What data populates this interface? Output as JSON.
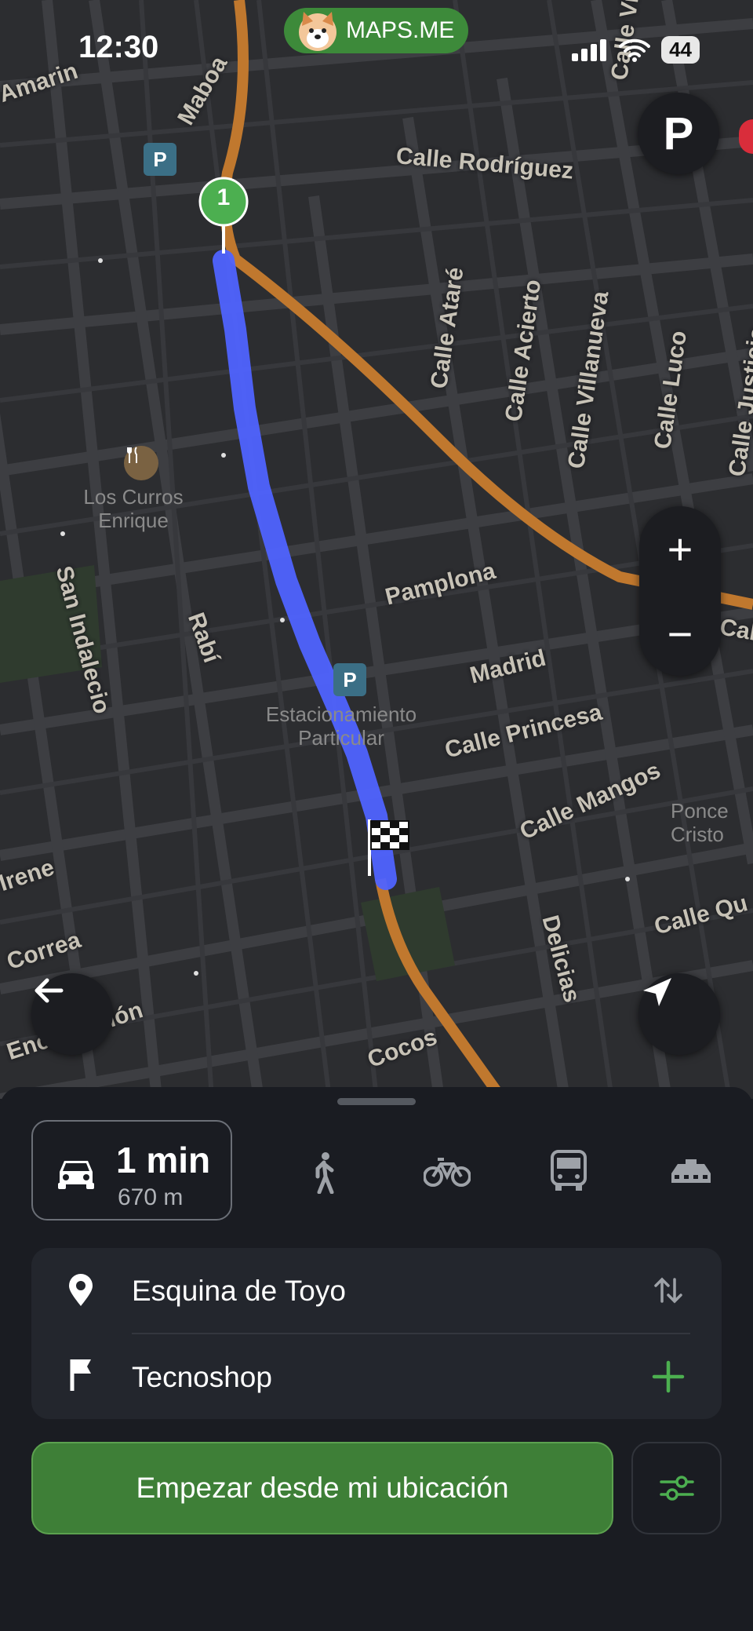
{
  "status": {
    "time": "12:30",
    "battery": "44",
    "app_pill": "MAPS.ME"
  },
  "map": {
    "streets": [
      "Maboa",
      "Calle Rodríguez",
      "Calle Ataré",
      "Calle Acierto",
      "Calle Villanueva",
      "Calle Luco",
      "Calle Justicia",
      "Pamplona",
      "Madrid",
      "Calle Princesa",
      "Calle Mangos",
      "Delicias",
      "Calle Qu",
      "Cocos",
      "Correa",
      "Irene",
      "San Indalecio",
      "Rabí",
      "Encarnación",
      "Amarin",
      "Calle Vi",
      "Calle"
    ],
    "pois": [
      "Los Curros Enrique",
      "Estacionamiento Particular",
      "Ponce Cristo"
    ],
    "start_marker": "1",
    "parking_button": "P"
  },
  "route": {
    "duration": "1 min",
    "distance": "670 m",
    "modes": [
      "car-icon",
      "walk-icon",
      "bike-icon",
      "bus-icon",
      "taxi-icon"
    ],
    "from": "Esquina de Toyo",
    "to": "Tecnoshop",
    "start_button": "Empezar desde mi ubicación"
  },
  "colors": {
    "accent": "#3e7f37",
    "route": "#4f63ff",
    "road_primary": "#c0782e"
  }
}
